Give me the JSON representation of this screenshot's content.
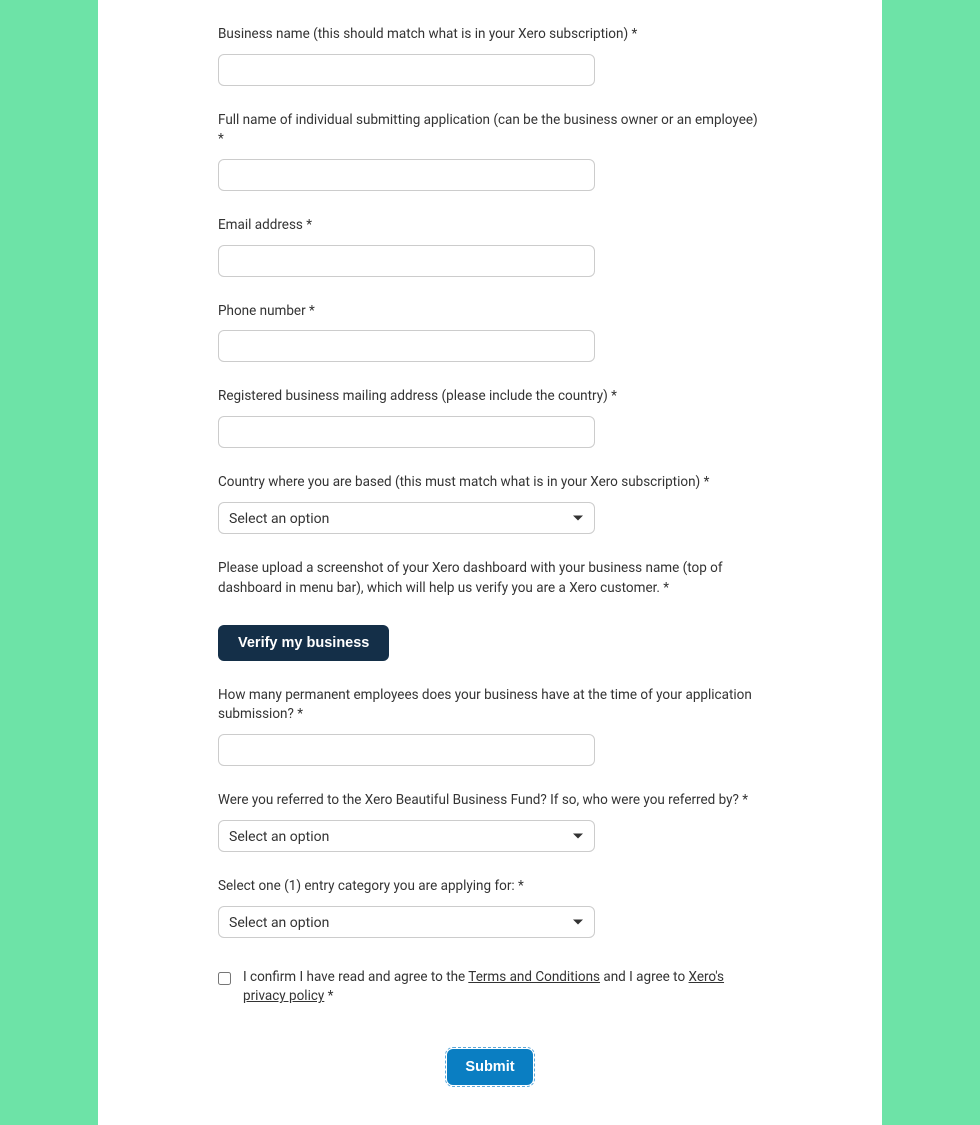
{
  "fields": {
    "business_name": {
      "label": "Business name (this should match what is in your Xero subscription) *"
    },
    "full_name": {
      "label": "Full name of individual submitting application (can be the business owner or an employee) *"
    },
    "email": {
      "label": "Email address *"
    },
    "phone": {
      "label": "Phone number *"
    },
    "mailing_address": {
      "label": "Registered business mailing address (please include the country) *"
    },
    "country": {
      "label": "Country where you are based (this must match what is in your Xero subscription) *",
      "placeholder": "Select an option"
    },
    "upload_instruction": "Please upload a screenshot of your Xero dashboard with your business name (top of dashboard in menu bar), which will help us verify you are a Xero customer. *",
    "verify_button": "Verify my business",
    "employees": {
      "label": "How many permanent employees does your business have at the time of your application submission? *"
    },
    "referred": {
      "label": "Were you referred to the Xero Beautiful Business Fund? If so, who were you referred by? *",
      "placeholder": "Select an option"
    },
    "category": {
      "label": "Select one (1) entry category you are applying for: *",
      "placeholder": "Select an option"
    }
  },
  "confirm": {
    "pre": "I confirm I have read and agree to the ",
    "terms": "Terms and Conditions",
    "mid": " and I agree to ",
    "privacy": "Xero's privacy policy",
    "post": " *"
  },
  "submit_label": "Submit"
}
